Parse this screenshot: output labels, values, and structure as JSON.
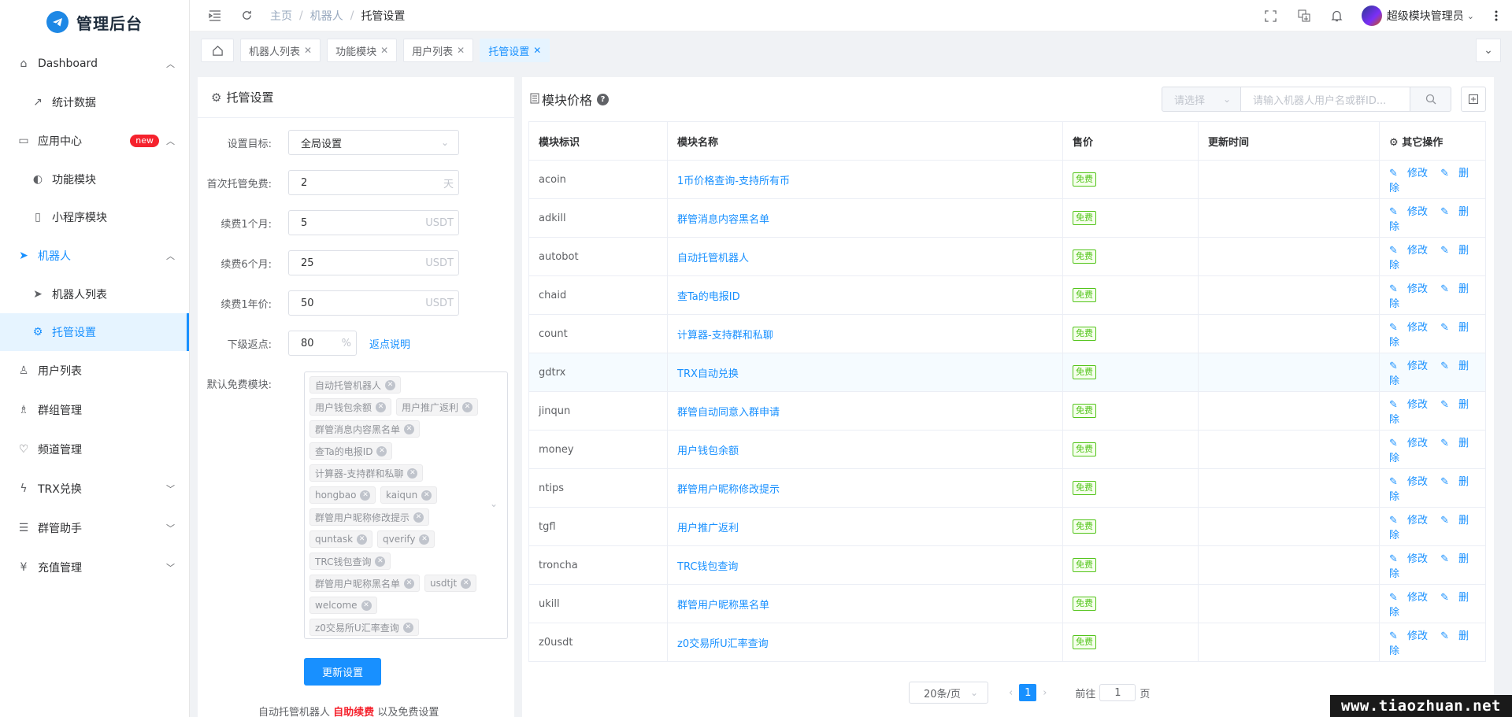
{
  "app": {
    "title": "管理后台"
  },
  "sidebar": {
    "items": [
      {
        "label": "Dashboard",
        "icon": "home-icon"
      },
      {
        "label": "统计数据",
        "icon": "trend-icon"
      },
      {
        "label": "应用中心",
        "icon": "app-icon",
        "badge": "new"
      },
      {
        "label": "功能模块",
        "icon": "toggle-icon"
      },
      {
        "label": "小程序模块",
        "icon": "phone-icon"
      },
      {
        "label": "机器人",
        "icon": "paper-plane-icon"
      },
      {
        "label": "机器人列表",
        "icon": "paper-plane-icon"
      },
      {
        "label": "托管设置",
        "icon": "gears-icon"
      },
      {
        "label": "用户列表",
        "icon": "user-icon"
      },
      {
        "label": "群组管理",
        "icon": "users-icon"
      },
      {
        "label": "频道管理",
        "icon": "heart-icon"
      },
      {
        "label": "TRX兑换",
        "icon": "lightning-icon"
      },
      {
        "label": "群管助手",
        "icon": "sliders-icon"
      },
      {
        "label": "充值管理",
        "icon": "yen-icon"
      }
    ]
  },
  "topbar": {
    "breadcrumb": [
      "主页",
      "机器人",
      "托管设置"
    ],
    "user_name": "超级模块管理员"
  },
  "tags": [
    "机器人列表",
    "功能模块",
    "用户列表",
    "托管设置"
  ],
  "form": {
    "title": "托管设置",
    "target_label": "设置目标:",
    "target_value": "全局设置",
    "free_label": "首次托管免费:",
    "free_value": "2",
    "free_unit": "天",
    "m1_label": "续费1个月:",
    "m1_value": "5",
    "m6_label": "续费6个月:",
    "m6_value": "25",
    "y1_label": "续费1年价:",
    "y1_value": "50",
    "unit_usdt": "USDT",
    "rebate_label": "下级返点:",
    "rebate_value": "80",
    "rebate_unit": "%",
    "rebate_link": "返点说明",
    "modules_label": "默认免费模块:",
    "modules": [
      "自动托管机器人",
      "用户钱包余额",
      "用户推广返利",
      "群管消息内容黑名单",
      "查Ta的电报ID",
      "计算器-支持群和私聊",
      "hongbao",
      "kaiqun",
      "群管用户昵称修改提示",
      "quntask",
      "qverify",
      "TRC钱包查询",
      "群管用户昵称黑名单",
      "usdtjt",
      "welcome",
      "z0交易所U汇率查询"
    ],
    "submit": "更新设置",
    "note_a": "自动托管机器人",
    "note_red": "自助续费",
    "note_b": "以及免费设置"
  },
  "table": {
    "title": "模块价格",
    "select_placeholder": "请选择",
    "search_placeholder": "请输入机器人用户名或群ID...",
    "headers": [
      "模块标识",
      "模块名称",
      "售价",
      "更新时间",
      "其它操作"
    ],
    "price_label": "免费",
    "edit_label": "修改",
    "delete_label": "删除",
    "rows": [
      {
        "id": "acoin",
        "name": "1币价格查询-支持所有币"
      },
      {
        "id": "adkill",
        "name": "群管消息内容黑名单"
      },
      {
        "id": "autobot",
        "name": "自动托管机器人"
      },
      {
        "id": "chaid",
        "name": "查Ta的电报ID"
      },
      {
        "id": "count",
        "name": "计算器-支持群和私聊"
      },
      {
        "id": "gdtrx",
        "name": "TRX自动兑换"
      },
      {
        "id": "jinqun",
        "name": "群管自动同意入群申请"
      },
      {
        "id": "money",
        "name": "用户钱包余额"
      },
      {
        "id": "ntips",
        "name": "群管用户昵称修改提示"
      },
      {
        "id": "tgfl",
        "name": "用户推广返利"
      },
      {
        "id": "troncha",
        "name": "TRC钱包查询"
      },
      {
        "id": "ukill",
        "name": "群管用户昵称黑名单"
      },
      {
        "id": "z0usdt",
        "name": "z0交易所U汇率查询"
      }
    ],
    "page_size": "20条/页",
    "current_page": "1",
    "goto_label": "前往",
    "goto_value": "1",
    "page_unit": "页"
  },
  "watermark": "www.tiaozhuan.net",
  "colors": {
    "primary": "#1890ff",
    "badge_red": "#f5222d",
    "free_green": "#52c41a"
  }
}
